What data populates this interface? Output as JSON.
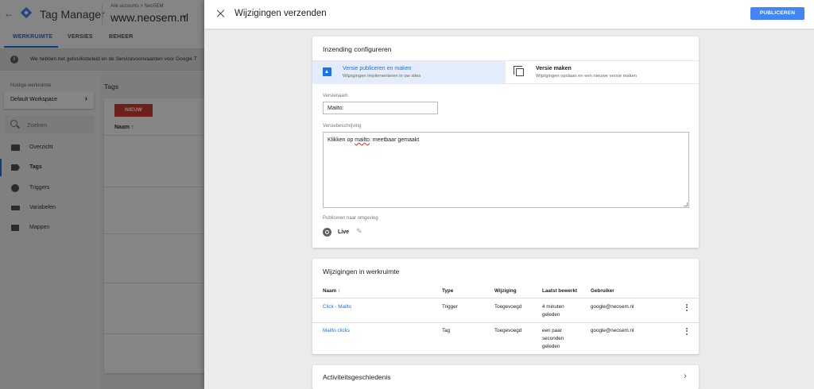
{
  "app": {
    "title": "Tag Manager",
    "breadcrumb": "Alle accounts > NeoSEM",
    "container": "www.neosem.nl"
  },
  "bg_tabs": [
    {
      "label": "WERKRUIMTE",
      "active": true
    },
    {
      "label": "VERSIES",
      "active": false
    },
    {
      "label": "BEHEER",
      "active": false
    }
  ],
  "notice": "We hebben het gebruiksbeleid en de Servicevoorwaarden voor Google T",
  "sidebar": {
    "workspace_label": "Huidige werkruimte",
    "workspace_value": "Default Workspace",
    "search_placeholder": "Zoeken",
    "items": [
      {
        "label": "Overzicht",
        "icon": "briefcase-icon"
      },
      {
        "label": "Tags",
        "icon": "tag-icon",
        "active": true
      },
      {
        "label": "Triggers",
        "icon": "trigger-icon"
      },
      {
        "label": "Variabelen",
        "icon": "variable-icon"
      },
      {
        "label": "Mappen",
        "icon": "folder-icon"
      }
    ]
  },
  "bg_main": {
    "title": "Tags",
    "new_button": "NIEUW",
    "column": "Naam ↑"
  },
  "panel": {
    "title": "Wijzigingen verzenden",
    "publish_button": "PUBLICEREN",
    "config": {
      "title": "Inzending configureren",
      "option_publish_title": "Versie publiceren en maken",
      "option_publish_sub": "Wijzigingen implementeren in uw sites",
      "option_version_title": "Versie maken",
      "option_version_sub": "Wijzigingen opslaan en een nieuwe versie maken",
      "version_name_label": "Versienaam",
      "version_name_value": "Mailto:",
      "description_label": "Versiebeschrijving",
      "description_pre": "Klikken op ",
      "description_misspelled": "mailto",
      "description_post": ": meetbaar gemaakt",
      "env_label": "Publiceren naar omgeving",
      "env_value": "Live"
    },
    "changes": {
      "title": "Wijzigingen in werkruimte",
      "headers": [
        "Naam ↑",
        "Type",
        "Wijziging",
        "Laatst bewerkt",
        "Gebruiker"
      ],
      "rows": [
        {
          "name": "Click - Mailto",
          "type": "Trigger",
          "change": "Toegevoegd",
          "edited": [
            "4 minuten",
            "geleden"
          ],
          "user": "google@neosem.nl"
        },
        {
          "name": "Mailto clicks",
          "type": "Tag",
          "change": "Toegevoegd",
          "edited": [
            "een paar",
            "seconden",
            "geleden"
          ],
          "user": "google@neosem.nl"
        }
      ]
    },
    "activity": {
      "title": "Activiteitsgeschiedenis"
    }
  },
  "colors": {
    "accent": "#4285f4",
    "link": "#1a73e8",
    "new_button": "#d23f31"
  }
}
